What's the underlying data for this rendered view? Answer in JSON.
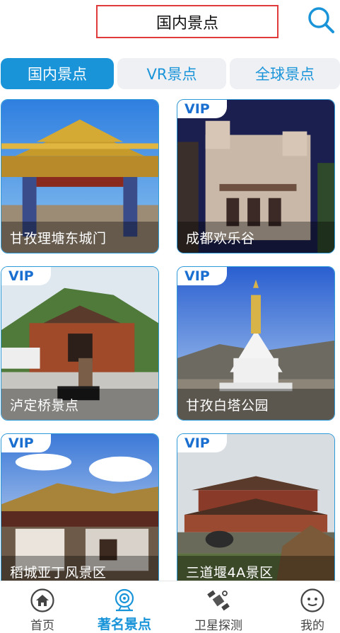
{
  "header": {
    "title": "国内景点",
    "search_icon": "search-icon"
  },
  "tabs": [
    {
      "label": "国内景点",
      "active": true
    },
    {
      "label": "VR景点",
      "active": false
    },
    {
      "label": "全球景点",
      "active": false
    }
  ],
  "cards": [
    {
      "caption": "甘孜理塘东城门",
      "vip": false
    },
    {
      "caption": "成都欢乐谷",
      "vip": true,
      "vip_label": "VIP"
    },
    {
      "caption": "泸定桥景点",
      "vip": true,
      "vip_label": "VIP"
    },
    {
      "caption": "甘孜白塔公园",
      "vip": true,
      "vip_label": "VIP"
    },
    {
      "caption": "稻城亚丁风景区",
      "vip": true,
      "vip_label": "VIP"
    },
    {
      "caption": "三道堰4A景区",
      "vip": true,
      "vip_label": "VIP"
    }
  ],
  "bottom_nav": [
    {
      "label": "首页",
      "icon": "home-icon",
      "active": false
    },
    {
      "label": "著名景点",
      "icon": "camera-icon",
      "active": true
    },
    {
      "label": "卫星探测",
      "icon": "satellite-icon",
      "active": false
    },
    {
      "label": "我的",
      "icon": "profile-icon",
      "active": false
    }
  ],
  "colors": {
    "accent": "#1a94d9",
    "highlight_border": "#e03a3a",
    "vip_text": "#1a6fd0"
  }
}
